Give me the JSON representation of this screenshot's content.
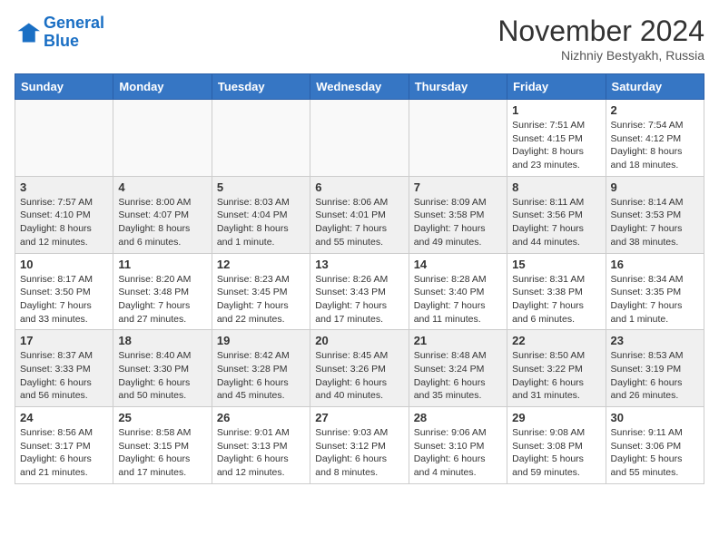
{
  "logo": {
    "line1": "General",
    "line2": "Blue"
  },
  "title": "November 2024",
  "location": "Nizhniy Bestyakh, Russia",
  "weekdays": [
    "Sunday",
    "Monday",
    "Tuesday",
    "Wednesday",
    "Thursday",
    "Friday",
    "Saturday"
  ],
  "weeks": [
    [
      {
        "day": "",
        "info": ""
      },
      {
        "day": "",
        "info": ""
      },
      {
        "day": "",
        "info": ""
      },
      {
        "day": "",
        "info": ""
      },
      {
        "day": "",
        "info": ""
      },
      {
        "day": "1",
        "info": "Sunrise: 7:51 AM\nSunset: 4:15 PM\nDaylight: 8 hours\nand 23 minutes."
      },
      {
        "day": "2",
        "info": "Sunrise: 7:54 AM\nSunset: 4:12 PM\nDaylight: 8 hours\nand 18 minutes."
      }
    ],
    [
      {
        "day": "3",
        "info": "Sunrise: 7:57 AM\nSunset: 4:10 PM\nDaylight: 8 hours\nand 12 minutes."
      },
      {
        "day": "4",
        "info": "Sunrise: 8:00 AM\nSunset: 4:07 PM\nDaylight: 8 hours\nand 6 minutes."
      },
      {
        "day": "5",
        "info": "Sunrise: 8:03 AM\nSunset: 4:04 PM\nDaylight: 8 hours\nand 1 minute."
      },
      {
        "day": "6",
        "info": "Sunrise: 8:06 AM\nSunset: 4:01 PM\nDaylight: 7 hours\nand 55 minutes."
      },
      {
        "day": "7",
        "info": "Sunrise: 8:09 AM\nSunset: 3:58 PM\nDaylight: 7 hours\nand 49 minutes."
      },
      {
        "day": "8",
        "info": "Sunrise: 8:11 AM\nSunset: 3:56 PM\nDaylight: 7 hours\nand 44 minutes."
      },
      {
        "day": "9",
        "info": "Sunrise: 8:14 AM\nSunset: 3:53 PM\nDaylight: 7 hours\nand 38 minutes."
      }
    ],
    [
      {
        "day": "10",
        "info": "Sunrise: 8:17 AM\nSunset: 3:50 PM\nDaylight: 7 hours\nand 33 minutes."
      },
      {
        "day": "11",
        "info": "Sunrise: 8:20 AM\nSunset: 3:48 PM\nDaylight: 7 hours\nand 27 minutes."
      },
      {
        "day": "12",
        "info": "Sunrise: 8:23 AM\nSunset: 3:45 PM\nDaylight: 7 hours\nand 22 minutes."
      },
      {
        "day": "13",
        "info": "Sunrise: 8:26 AM\nSunset: 3:43 PM\nDaylight: 7 hours\nand 17 minutes."
      },
      {
        "day": "14",
        "info": "Sunrise: 8:28 AM\nSunset: 3:40 PM\nDaylight: 7 hours\nand 11 minutes."
      },
      {
        "day": "15",
        "info": "Sunrise: 8:31 AM\nSunset: 3:38 PM\nDaylight: 7 hours\nand 6 minutes."
      },
      {
        "day": "16",
        "info": "Sunrise: 8:34 AM\nSunset: 3:35 PM\nDaylight: 7 hours\nand 1 minute."
      }
    ],
    [
      {
        "day": "17",
        "info": "Sunrise: 8:37 AM\nSunset: 3:33 PM\nDaylight: 6 hours\nand 56 minutes."
      },
      {
        "day": "18",
        "info": "Sunrise: 8:40 AM\nSunset: 3:30 PM\nDaylight: 6 hours\nand 50 minutes."
      },
      {
        "day": "19",
        "info": "Sunrise: 8:42 AM\nSunset: 3:28 PM\nDaylight: 6 hours\nand 45 minutes."
      },
      {
        "day": "20",
        "info": "Sunrise: 8:45 AM\nSunset: 3:26 PM\nDaylight: 6 hours\nand 40 minutes."
      },
      {
        "day": "21",
        "info": "Sunrise: 8:48 AM\nSunset: 3:24 PM\nDaylight: 6 hours\nand 35 minutes."
      },
      {
        "day": "22",
        "info": "Sunrise: 8:50 AM\nSunset: 3:22 PM\nDaylight: 6 hours\nand 31 minutes."
      },
      {
        "day": "23",
        "info": "Sunrise: 8:53 AM\nSunset: 3:19 PM\nDaylight: 6 hours\nand 26 minutes."
      }
    ],
    [
      {
        "day": "24",
        "info": "Sunrise: 8:56 AM\nSunset: 3:17 PM\nDaylight: 6 hours\nand 21 minutes."
      },
      {
        "day": "25",
        "info": "Sunrise: 8:58 AM\nSunset: 3:15 PM\nDaylight: 6 hours\nand 17 minutes."
      },
      {
        "day": "26",
        "info": "Sunrise: 9:01 AM\nSunset: 3:13 PM\nDaylight: 6 hours\nand 12 minutes."
      },
      {
        "day": "27",
        "info": "Sunrise: 9:03 AM\nSunset: 3:12 PM\nDaylight: 6 hours\nand 8 minutes."
      },
      {
        "day": "28",
        "info": "Sunrise: 9:06 AM\nSunset: 3:10 PM\nDaylight: 6 hours\nand 4 minutes."
      },
      {
        "day": "29",
        "info": "Sunrise: 9:08 AM\nSunset: 3:08 PM\nDaylight: 5 hours\nand 59 minutes."
      },
      {
        "day": "30",
        "info": "Sunrise: 9:11 AM\nSunset: 3:06 PM\nDaylight: 5 hours\nand 55 minutes."
      }
    ]
  ]
}
